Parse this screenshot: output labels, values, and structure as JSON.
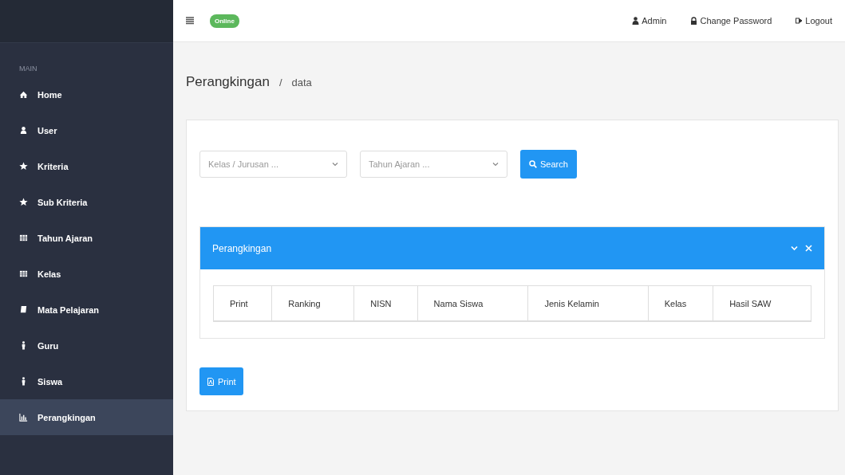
{
  "header": {
    "status_badge": "Online",
    "links": [
      "Admin",
      "Change Password",
      "Logout"
    ]
  },
  "sidebar": {
    "section": "MAIN",
    "items": [
      {
        "label": "Home",
        "selected": false
      },
      {
        "label": "User",
        "selected": false
      },
      {
        "label": "Kriteria",
        "selected": false
      },
      {
        "label": "Sub Kriteria",
        "selected": false
      },
      {
        "label": "Tahun Ajaran",
        "selected": false
      },
      {
        "label": "Kelas",
        "selected": false
      },
      {
        "label": "Mata Pelajaran",
        "selected": false
      },
      {
        "label": "Guru",
        "selected": false
      },
      {
        "label": "Siswa",
        "selected": false
      },
      {
        "label": "Perangkingan",
        "selected": true
      }
    ]
  },
  "page": {
    "title": "Perangkingan",
    "separator": "/",
    "subtitle": "data"
  },
  "filters": {
    "selects": [
      {
        "placeholder": "Kelas / Jurusan ..."
      },
      {
        "placeholder": "Tahun Ajaran ..."
      }
    ],
    "search_button": "Search"
  },
  "panel": {
    "title": "Perangkingan",
    "table": {
      "columns": [
        "Print",
        "Ranking",
        "NISN",
        "Nama Siswa",
        "Jenis Kelamin",
        "Kelas",
        "Hasil SAW"
      ]
    }
  },
  "print_button": "Print"
}
